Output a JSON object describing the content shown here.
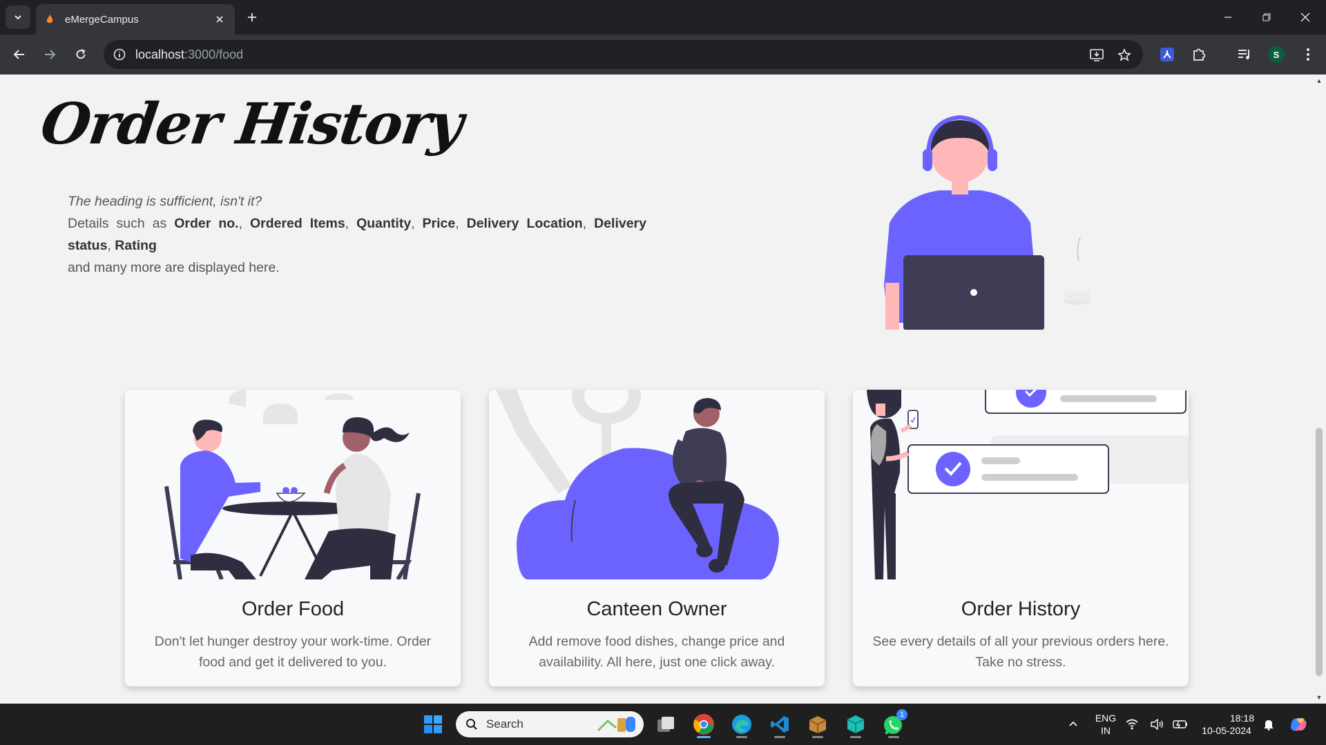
{
  "browser": {
    "tab_title": "eMergeCampus",
    "url_host": "localhost",
    "url_rest": ":3000/food",
    "profile_letter": "S"
  },
  "hero": {
    "title": "Order History",
    "tagline": "The heading is sufficient, isn't it?",
    "details_prefix": "Details such as",
    "fields": [
      "Order no.",
      "Ordered Items",
      "Quantity",
      "Price",
      "Delivery Location",
      "Delivery status",
      "Rating"
    ],
    "details_suffix": "and many more are displayed here."
  },
  "cards": [
    {
      "title": "Order Food",
      "description": "Don't let hunger destroy your work-time. Order food and get it delivered to you."
    },
    {
      "title": "Canteen Owner",
      "description": "Add remove food dishes, change price and availability. All here, just one click away."
    },
    {
      "title": "Order History",
      "description": "See every details of all your previous orders here. Take no stress."
    }
  ],
  "taskbar": {
    "search_label": "Search",
    "lang_line1": "ENG",
    "lang_line2": "IN",
    "time": "18:18",
    "date": "10-05-2024",
    "whatsapp_badge": "1"
  },
  "colors": {
    "accent": "#6c63ff",
    "dark": "#3f3d56",
    "skin": "#ffb8b8"
  }
}
